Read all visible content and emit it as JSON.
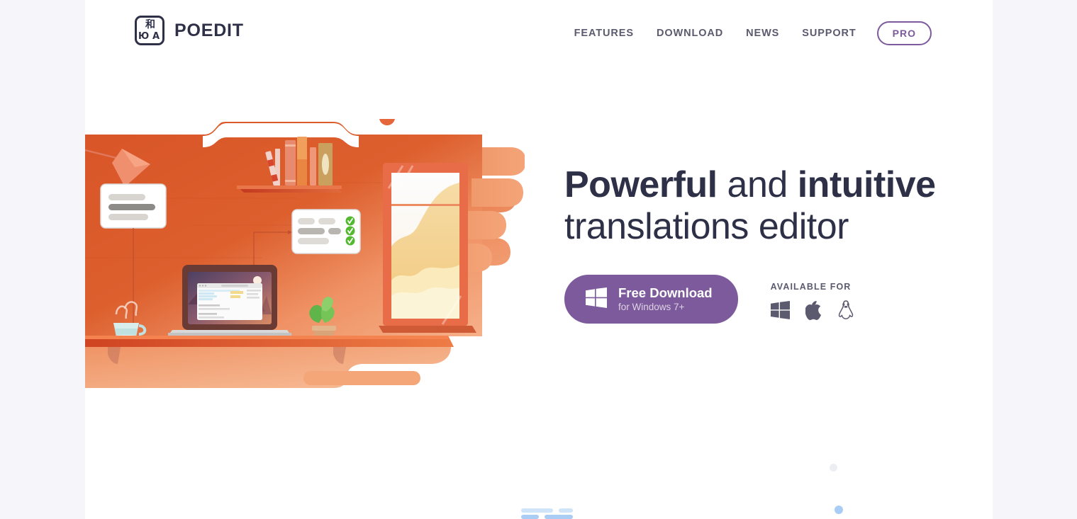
{
  "site": {
    "brand_name": "POEDIT",
    "logo_glyphs": [
      "和",
      "Ю",
      "A"
    ]
  },
  "nav": {
    "items": [
      {
        "label": "FEATURES",
        "name": "nav-link-features"
      },
      {
        "label": "DOWNLOAD",
        "name": "nav-link-download"
      },
      {
        "label": "NEWS",
        "name": "nav-link-news"
      },
      {
        "label": "SUPPORT",
        "name": "nav-link-support"
      }
    ],
    "pro_label": "PRO"
  },
  "hero": {
    "heading_part1": "Powerful",
    "heading_part2": " and ",
    "heading_part3": "intuitive",
    "heading_line2": "translations editor",
    "download": {
      "title": "Free Download",
      "subtitle": "for Windows 7+",
      "icon": "windows-icon"
    },
    "available": {
      "label": "AVAILABLE FOR",
      "platforms": [
        {
          "name": "windows-icon",
          "label": "Windows"
        },
        {
          "name": "apple-icon",
          "label": "macOS"
        },
        {
          "name": "linux-icon",
          "label": "Linux"
        }
      ]
    },
    "illustration": {
      "name": "workspace-illustration",
      "description": "Orange illustrated workspace with laptop, shelf of books, window with landscape, floating translation cards, coffee cup and plant"
    }
  },
  "colors": {
    "accent_purple": "#7d5a9b",
    "heading_navy": "#2e3047",
    "nav_gray": "#5c5a6e",
    "page_background": "#ffffff",
    "outer_background": "#f6f6fa",
    "illustration_orange": "#d9552c",
    "illustration_peach": "#f2a179",
    "check_green": "#52b830",
    "peek_blue": "#a9cdf5"
  }
}
